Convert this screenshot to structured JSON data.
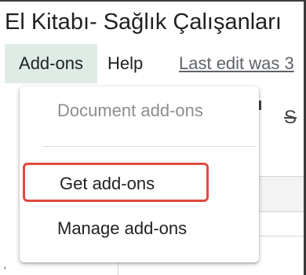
{
  "document": {
    "title": "El Kitabı- Sağlık Çalışanları"
  },
  "menubar": {
    "addons_label": "Add-ons",
    "help_label": "Help",
    "last_edit_text": "Last edit was 3"
  },
  "toolbar": {
    "strikethrough_symbol": "S"
  },
  "addons_menu": {
    "section_header": "Document add-ons",
    "items": [
      {
        "label": "Get add-ons",
        "highlighted": true
      },
      {
        "label": "Manage add-ons",
        "highlighted": false
      }
    ]
  },
  "colors": {
    "active_menu_bg": "#dfece5",
    "highlight_border": "#e04a3f",
    "disabled_text": "#8a8d91"
  }
}
